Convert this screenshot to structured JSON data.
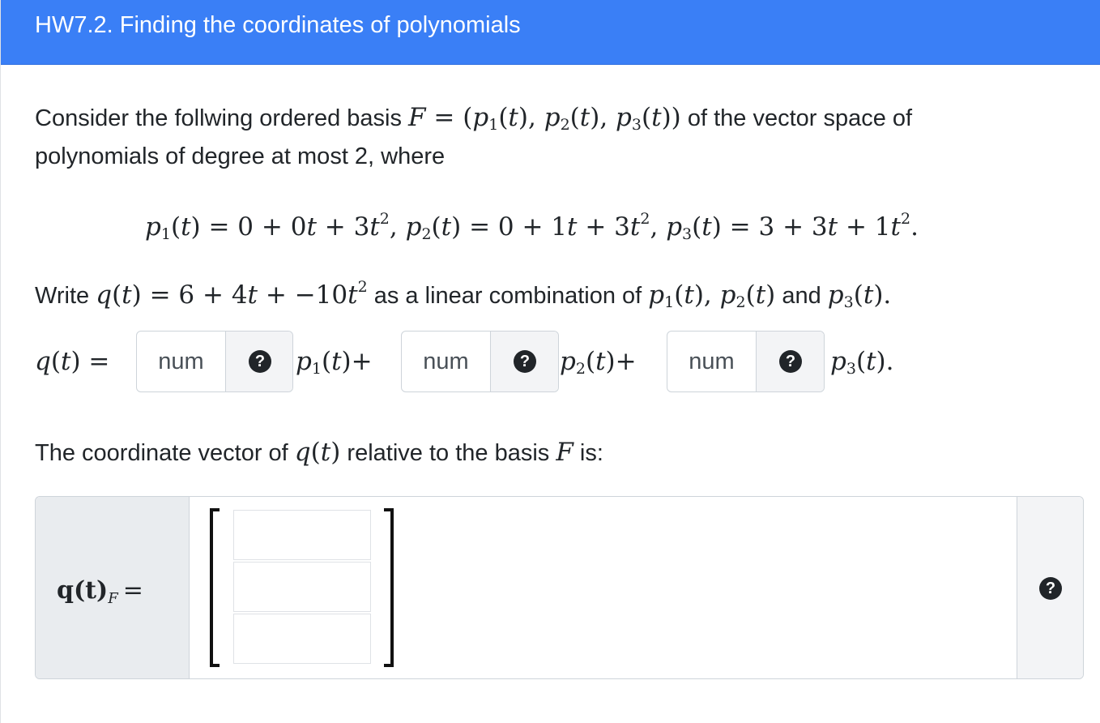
{
  "header": {
    "title": "HW7.2. Finding the coordinates of polynomials"
  },
  "intro": {
    "line1_prefix": "Consider the follwing ordered basis",
    "basis_symbol": "F",
    "equals": "=",
    "basis_tuple": "(p",
    "line1_suffix": "of the vector space of",
    "line2": "polynomials of degree at most 2, where"
  },
  "definitions": {
    "p1": "p1(t) = 0 + 0t + 3t², ",
    "p2": "p2(t) = 0 + 1t + 3t², ",
    "p3": "p3(t) = 3 + 3t + 1t²."
  },
  "task": {
    "prefix": "Write",
    "q_expr": "q(t) = 6 + 4t + −10t²",
    "middle": "as a linear combination of",
    "basis_list": "p1(t), p2(t)",
    "and": "and",
    "last": "p3(t)."
  },
  "combination": {
    "lhs": "q(t) =",
    "terms": [
      {
        "placeholder": "num",
        "after": "p1(t)+"
      },
      {
        "placeholder": "num",
        "after": "p2(t)+"
      },
      {
        "placeholder": "num",
        "after": "p3(t)."
      }
    ],
    "help_glyph": "?"
  },
  "coordinate": {
    "sentence_prefix": "The coordinate vector of",
    "q": "q(t)",
    "sentence_middle": "relative to the basis",
    "basis_symbol": "F",
    "sentence_suffix": "is:",
    "label_main": "q(t)",
    "label_sub": "F",
    "label_eq": "=",
    "help_glyph": "?"
  },
  "colors": {
    "header_bg": "#3a7ff6",
    "header_text": "#ffffff",
    "addon_bg": "#f3f4f6",
    "label_bg": "#e9ecef",
    "help_bg": "#212529"
  }
}
